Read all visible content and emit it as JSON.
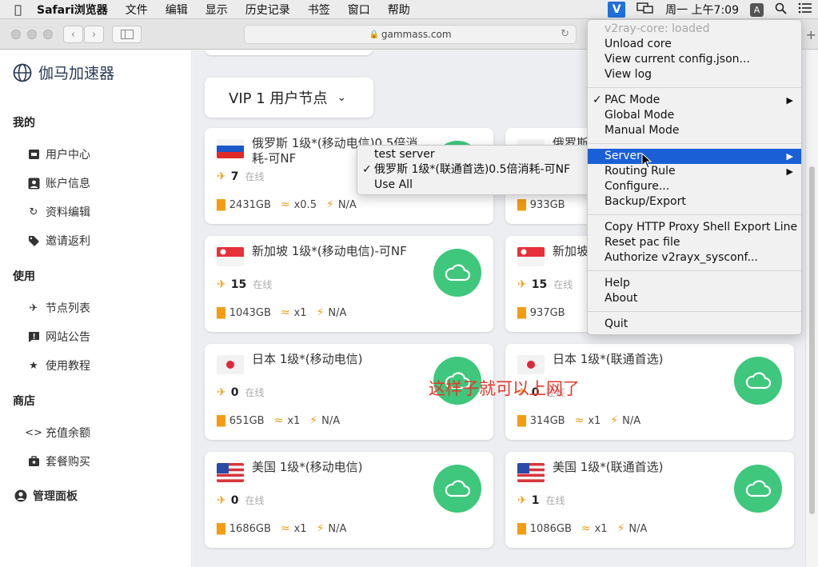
{
  "menubar": {
    "app": "Safari浏览器",
    "items": [
      "文件",
      "编辑",
      "显示",
      "历史记录",
      "书签",
      "窗口",
      "帮助"
    ],
    "v2ray_icon": "V",
    "clock": "周一 上午7:09",
    "ime": "A"
  },
  "browser": {
    "url": "gammass.com"
  },
  "sidebar": {
    "brand": "伽马加速器",
    "sections": [
      {
        "title": "我的",
        "items": [
          "用户中心",
          "账户信息",
          "资料编辑",
          "邀请返利"
        ]
      },
      {
        "title": "使用",
        "items": [
          "节点列表",
          "网站公告",
          "使用教程"
        ]
      },
      {
        "title": "商店",
        "items": [
          "充值余额",
          "套餐购买"
        ]
      }
    ],
    "admin": "管理面板"
  },
  "main": {
    "group_selector": "VIP 1 用户节点",
    "online_label": "在线",
    "annotation": "这样子就可以上网了",
    "nodes": [
      {
        "name": "俄罗斯 1级*(移动电信)0.5倍消耗-可NF",
        "flag": "ru",
        "online": "7",
        "traffic": "2431GB",
        "rate": "x0.5",
        "status": "N/A"
      },
      {
        "name": "俄罗斯",
        "flag": "ru",
        "online": "",
        "traffic": "933GB",
        "rate": "",
        "status": ""
      },
      {
        "name": "新加坡 1级*(移动电信)-可NF",
        "flag": "sg",
        "online": "15",
        "traffic": "1043GB",
        "rate": "x1",
        "status": "N/A"
      },
      {
        "name": "新加坡",
        "flag": "sg",
        "online": "15",
        "traffic": "937GB",
        "rate": "",
        "status": ""
      },
      {
        "name": "日本 1级*(移动电信)",
        "flag": "jp",
        "online": "0",
        "traffic": "651GB",
        "rate": "x1",
        "status": "N/A"
      },
      {
        "name": "日本 1级*(联通首选)",
        "flag": "jp",
        "online": "0",
        "traffic": "314GB",
        "rate": "x1",
        "status": "N/A"
      },
      {
        "name": "美国 1级*(移动电信)",
        "flag": "us",
        "online": "0",
        "traffic": "1686GB",
        "rate": "x1",
        "status": "N/A"
      },
      {
        "name": "美国 1级*(联通首选)",
        "flag": "us",
        "online": "1",
        "traffic": "1086GB",
        "rate": "x1",
        "status": "N/A"
      }
    ]
  },
  "v2ray_menu": {
    "status": "v2ray-core: loaded",
    "items1": [
      "Unload core",
      "View current config.json...",
      "View log"
    ],
    "modes": [
      "PAC Mode",
      "Global Mode",
      "Manual Mode"
    ],
    "checked_mode": "PAC Mode",
    "items2": [
      "Server",
      "Routing Rule",
      "Configure...",
      "Backup/Export"
    ],
    "items3": [
      "Copy HTTP Proxy Shell Export Line",
      "Reset pac file",
      "Authorize v2rayx_sysconf..."
    ],
    "items4": [
      "Help",
      "About"
    ],
    "quit": "Quit"
  },
  "server_submenu": {
    "items": [
      "test server",
      "俄罗斯 1级*(联通首选)0.5倍消耗-可NF",
      "Use All"
    ],
    "checked": "俄罗斯 1级*(联通首选)0.5倍消耗-可NF"
  },
  "colors": {
    "accent_green": "#3ec77d",
    "stat_orange": "#f39c12",
    "menu_selected": "#1a5fd6",
    "annotation_red": "#e5372b"
  }
}
